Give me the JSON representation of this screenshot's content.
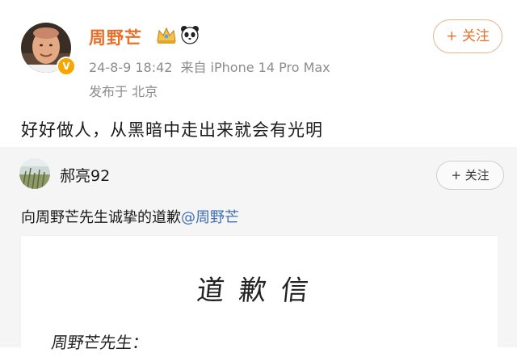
{
  "post": {
    "author_name": "周野芒",
    "badges": [
      "crown-badge-icon",
      "panda-icon"
    ],
    "verified_icon": "v-badge-icon",
    "time": "24-8-9 18:42",
    "source": "来自 iPhone 14 Pro Max",
    "location": "发布于 北京",
    "follow_label": "+ 关注",
    "content": "好好做人，从黑暗中走出来就会有光明"
  },
  "repost": {
    "author_name": "郝亮92",
    "follow_label": "+ 关注",
    "text": "向周野芒先生诚挚的道歉",
    "mention": "@周野芒",
    "letter": {
      "title": "道歉信",
      "salutation": "周野芒先生："
    }
  },
  "colors": {
    "name_orange": "#e8702a",
    "mention_blue": "#3f6fb5",
    "verified_gold": "#f7a600",
    "repost_bg": "#f5f5f5"
  }
}
